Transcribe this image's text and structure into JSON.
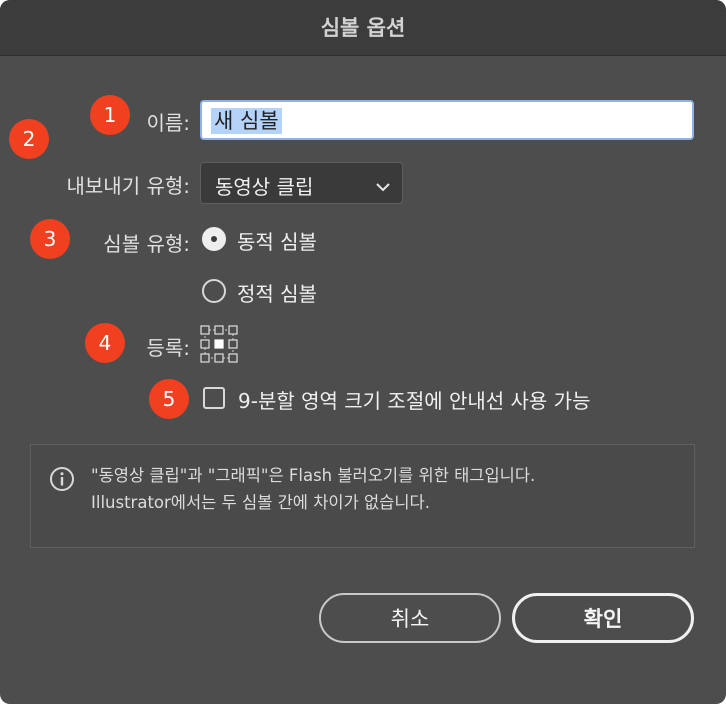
{
  "dialog": {
    "title": "심볼 옵션"
  },
  "annotations": [
    "1",
    "2",
    "3",
    "4",
    "5"
  ],
  "fields": {
    "name_label": "이름:",
    "name_value": "새 심볼",
    "export_type_label": "내보내기 유형:",
    "export_type_value": "동영상 클립",
    "symbol_type_label": "심볼 유형:",
    "symbol_type_options": [
      "동적 심볼",
      "정적 심볼"
    ],
    "symbol_type_selected": "동적 심볼",
    "registration_label": "등록:",
    "nine_slice_label": "9-분할 영역 크기 조절에 안내선 사용 가능",
    "nine_slice_checked": false
  },
  "info": {
    "icon": "info-icon",
    "line1": "\"동영상 클립\"과 \"그래픽\"은 Flash 불러오기를 위한 태그입니다.",
    "line2": "Illustrator에서는 두 심볼 간에 차이가 없습니다."
  },
  "buttons": {
    "cancel": "취소",
    "ok": "확인"
  },
  "colors": {
    "badge": "#f0401f",
    "selection": "#b5d2f8",
    "dialog_bg": "#4d4d4d"
  }
}
